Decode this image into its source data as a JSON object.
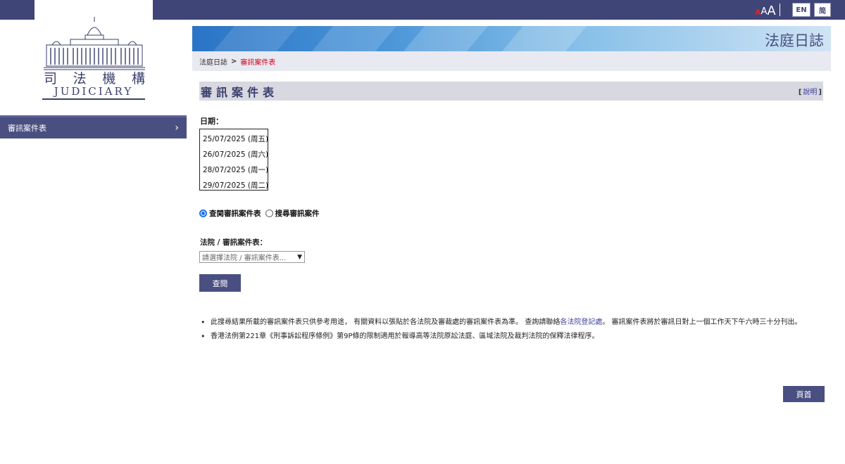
{
  "topbar": {
    "font_size_label_1": "A",
    "font_size_label_2": "A",
    "font_size_label_3": "A",
    "lang_en": "EN",
    "lang_sc": "简"
  },
  "logo": {
    "name_zh": [
      "司",
      "法",
      "機",
      "構"
    ],
    "name_en": "JUDICIARY"
  },
  "sidebar": {
    "items": [
      {
        "label": "審訊案件表",
        "chevron": "›"
      }
    ]
  },
  "banner": {
    "title": "法庭日誌"
  },
  "breadcrumb": {
    "home": "法庭日誌",
    "separator": ">",
    "current": "審訊案件表"
  },
  "section": {
    "title": "審訊案件表",
    "help_open": "[",
    "help_label": "說明",
    "help_close": "]"
  },
  "form": {
    "date_label": "日期：",
    "dates": [
      "25/07/2025 (周五)",
      "26/07/2025 (周六)",
      "28/07/2025 (周一)",
      "29/07/2025 (周二)"
    ],
    "radio_options": [
      {
        "label": "查閱審訊案件表",
        "selected": true
      },
      {
        "label": "搜尋審訊案件",
        "selected": false
      }
    ],
    "court_label": "法院 / 審訊案件表：",
    "court_placeholder": "請選擇法院 / 審訊案件表...",
    "view_button": "查閱"
  },
  "notes": {
    "note1_part1": "此搜尋結果所載的審訊案件表只供參考用途， 有關資料以張貼於各法院及審裁處的審訊案件表為準。 查詢請聯絡",
    "note1_link": "各法院登記處",
    "note1_part2": "。 審訊案件表將於審訊日對上一個工作天下午六時三十分刊出。",
    "note2": "香港法例第221章《刑事訴訟程序條例》第9P條的限制適用於報導高等法院原訟法庭、區域法院及裁判法院的保釋法律程序。"
  },
  "footer": {
    "top_button": "頁首"
  },
  "colors": {
    "topbar": "#3f4576",
    "menu": "#4a4f82",
    "accent_red": "#d0021b",
    "link": "#3a3f9a"
  }
}
